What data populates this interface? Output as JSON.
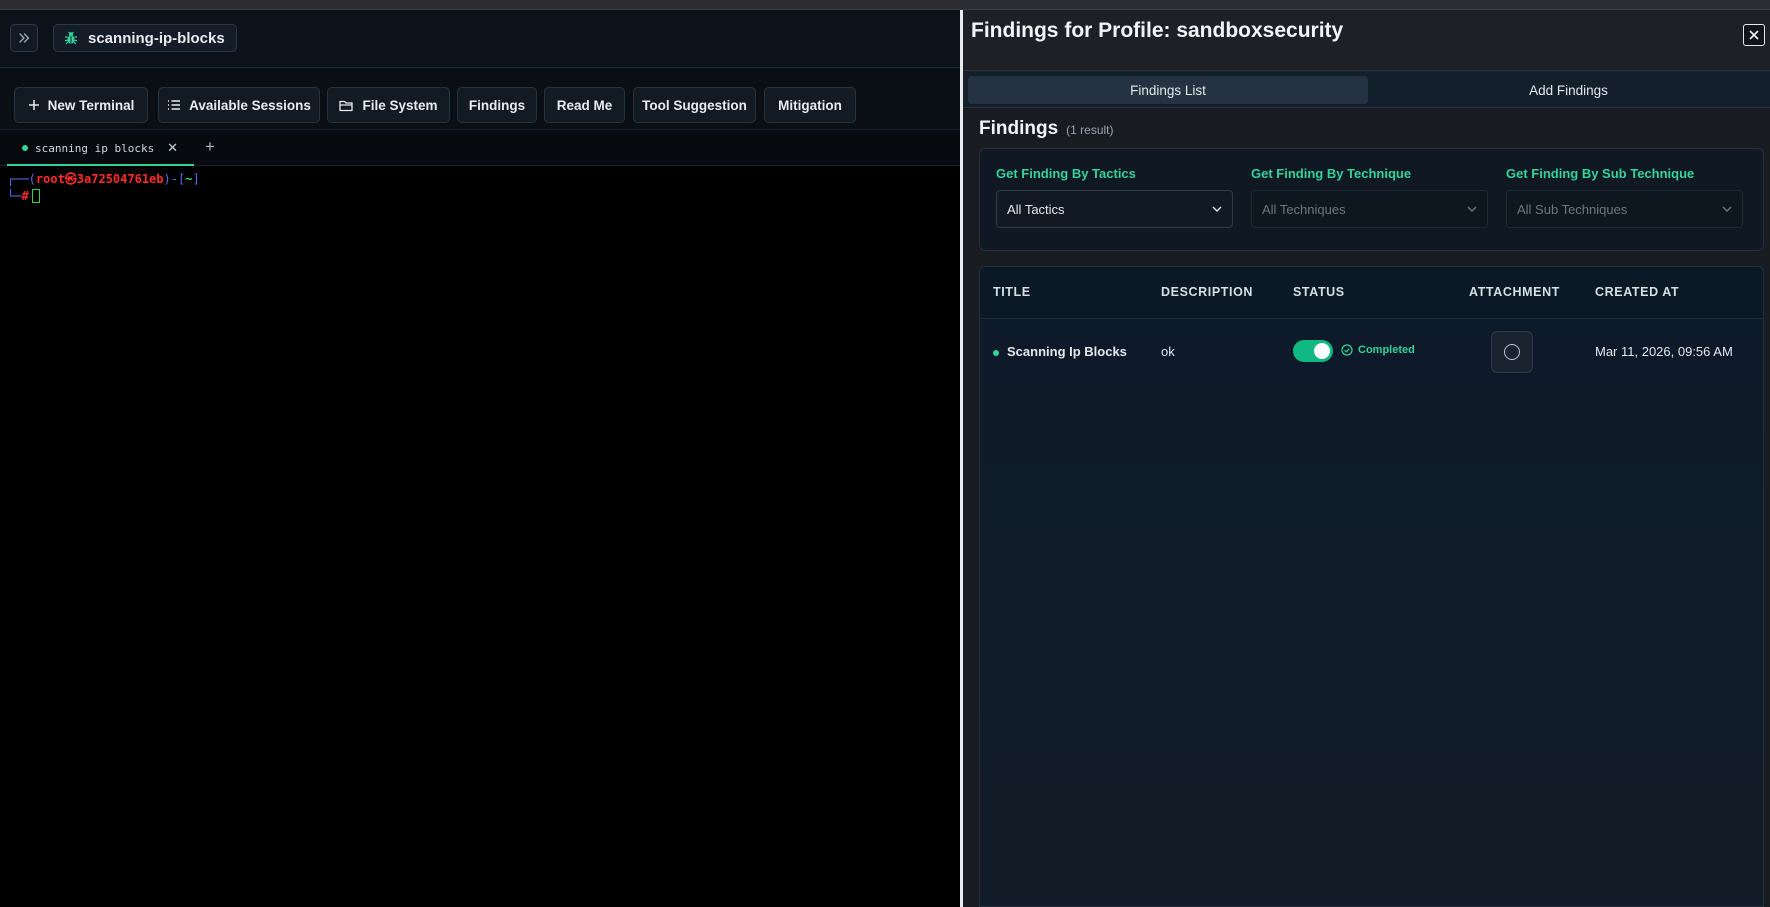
{
  "session": {
    "name": "scanning-ip-blocks"
  },
  "toolbar": {
    "new_terminal": "New Terminal",
    "available_sessions": "Available Sessions",
    "file_system": "File System",
    "findings": "Findings",
    "read_me": "Read Me",
    "tool_suggestion": "Tool Suggestion",
    "mitigation": "Mitigation"
  },
  "terminal_tab": {
    "label": "scanning ip blocks",
    "close": "✕",
    "add": "+"
  },
  "terminal": {
    "line1_prefix": "┌──(",
    "user": "root㉿3a72504761eb",
    "line1_mid": ")-[",
    "dir": "~",
    "line1_suffix": "]",
    "line2_prefix": "└─",
    "prompt": "#"
  },
  "panel": {
    "title": "Findings for Profile: sandboxsecurity",
    "close": "✕",
    "tabs": [
      "Findings List",
      "Add Findings"
    ],
    "heading": "Findings",
    "count": "(1 result)"
  },
  "filters": {
    "tactics": {
      "label": "Get Finding By Tactics",
      "value": "All Tactics"
    },
    "technique": {
      "label": "Get Finding By Technique",
      "value": "All Techniques"
    },
    "sub_technique": {
      "label": "Get Finding By Sub Technique",
      "value": "All Sub Techniques"
    }
  },
  "table": {
    "columns": [
      "TITLE",
      "DESCRIPTION",
      "STATUS",
      "ATTACHMENT",
      "CREATED AT"
    ],
    "rows": [
      {
        "title": "Scanning Ip Blocks",
        "description": "ok",
        "toggle_on": true,
        "status": "Completed",
        "created_at": "Mar 11, 2026, 09:56 AM"
      }
    ]
  },
  "colors": {
    "accent": "#34d399",
    "toggle": "#10b981",
    "prompt_red": "#ff2a2a",
    "prompt_blue": "#5b6cf0"
  },
  "icons": [
    "double-chevron-right-icon",
    "bug-icon",
    "plus-icon",
    "list-icon",
    "folder-icon",
    "close-icon",
    "chevron-down-icon",
    "check-circle-icon",
    "attachment-icon"
  ]
}
